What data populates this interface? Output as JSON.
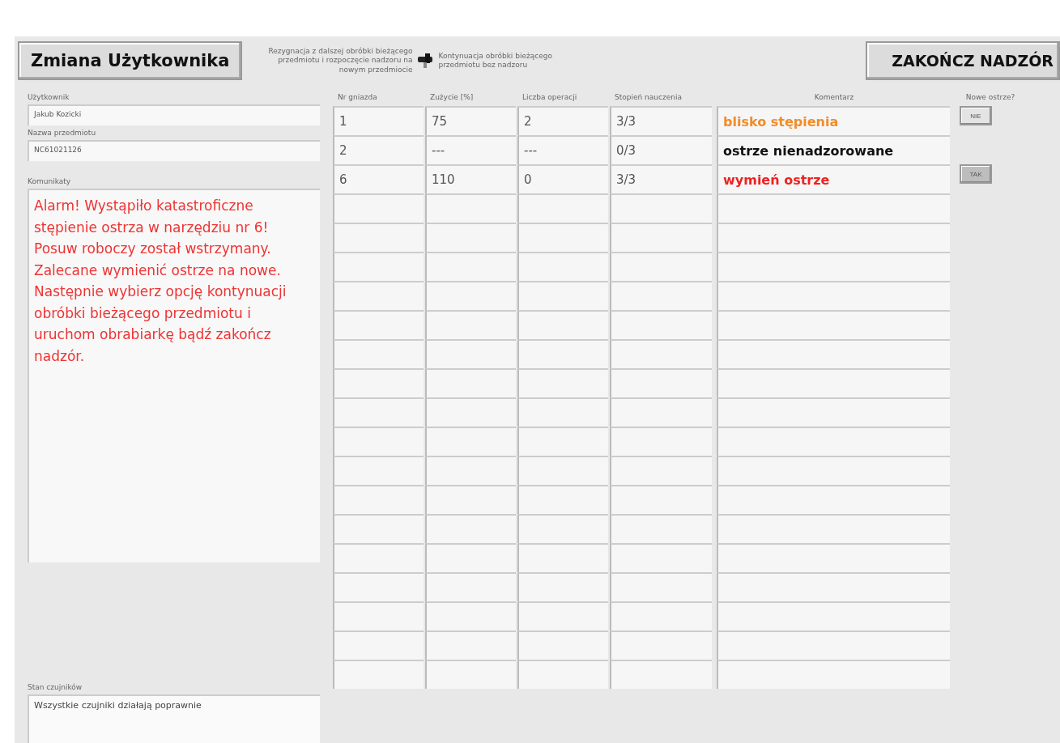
{
  "header": {
    "change_user_button": "Zmiana Użytkownika",
    "switch_left_label": "Rezygnacja z dalszej obróbki bieżącego przedmiotu i rozpoczęcie nadzoru na nowym przedmiocie",
    "switch_right_label": "Kontynuacja obróbki bieżącego przedmiotu bez nadzoru",
    "switch_on": true,
    "end_button": "ZAKOŃCZ NADZÓR"
  },
  "left": {
    "user_label": "Użytkownik",
    "user_value": "Jakub Kozicki",
    "item_label": "Nazwa przedmiotu",
    "item_value": "NC61021126",
    "messages_label": "Komunikaty",
    "message": "Alarm! Wystąpiło katastroficzne stępienie ostrza w narzędziu nr 6! Posuw roboczy został wstrzymany. Zalecane wymienić ostrze na nowe. Następnie wybierz opcję kontynuacji obróbki bieżącego przedmiotu i uruchom obrabiarkę bądź zakończ nadzór.",
    "sensors_label": "Stan czujników",
    "sensors_value": "Wszystkie czujniki działają poprawnie"
  },
  "table": {
    "columns": [
      "Nr gniazda",
      "Zużycie [%]",
      "Liczba operacji",
      "Stopień nauczenia",
      "Komentarz",
      "Nowe ostrze?"
    ],
    "rows": [
      {
        "slot": "1",
        "wear": "75",
        "operations": "2",
        "learning": "3/3",
        "comment": "blisko stępienia",
        "color": "#f28c28",
        "new_blade": {
          "label": "NIE",
          "pressed": false
        }
      },
      {
        "slot": "2",
        "wear": "---",
        "operations": "---",
        "learning": "0/3",
        "comment": "ostrze nienadzorowane",
        "color": "#111111"
      },
      {
        "slot": "6",
        "wear": "110",
        "operations": "0",
        "learning": "3/3",
        "comment": "wymień ostrze",
        "color": "#ee2222",
        "new_blade": {
          "label": "TAK",
          "pressed": true
        }
      }
    ]
  }
}
